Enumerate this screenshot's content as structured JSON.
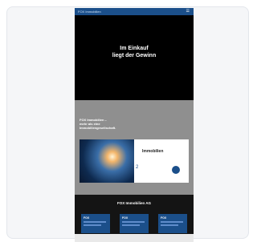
{
  "topbar": {
    "brand": "FOX Immobilien",
    "menu_icon": "menu-icon"
  },
  "hero": {
    "title_line1": "Im Einkauf",
    "title_line2": "liegt der Gewinn"
  },
  "section": {
    "heading_line1": "FOX Immobilien –",
    "heading_line2": "mehr als eine",
    "heading_line3": "Immobiliengesellschaft.",
    "side_text": "",
    "promo_tag": "Immobilien",
    "promo_number": "2",
    "promo_caption": ""
  },
  "dark": {
    "title": "FOX Immobilien AG",
    "tiles": [
      {
        "label": "FOX"
      },
      {
        "label": "FOX"
      },
      {
        "label": "FOX"
      }
    ]
  },
  "colors": {
    "accent": "#1b4f8a",
    "hero_bg": "#000000",
    "section_bg": "#8f8f8f"
  }
}
